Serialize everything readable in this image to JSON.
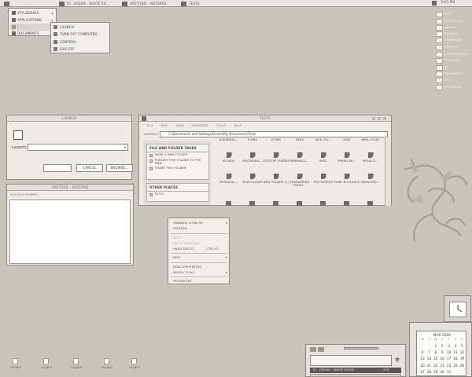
{
  "taskbar": {
    "tasks": [
      "01. Cream - White Ro...",
      "Untitled - Notepad",
      "Tests"
    ],
    "clock": "3:05 PM"
  },
  "start_menu": {
    "items": [
      "Styleboxes",
      "Applications",
      "Dmbra",
      "Documents"
    ]
  },
  "submenu": {
    "items": [
      "Launch",
      "Turn off computer...",
      "Control",
      "Log off"
    ]
  },
  "launch": {
    "title": "Launch",
    "label": "Launch:",
    "cancel": "Cancel",
    "browse": "Browse..."
  },
  "notepad": {
    "title": "Untitled - Notepad",
    "menu": "File Edit Format",
    "text": ""
  },
  "explorer": {
    "title": "Tests",
    "menu": [
      "File",
      "Edit",
      "View",
      "Favorites",
      "Tools",
      "Help"
    ],
    "address_label": "Address",
    "address": "C:\\Documents and Settings\\Daniel\\My Documents\\Tests",
    "tasks_title": "File and Folder Tasks",
    "tasks": [
      "Make a new folder",
      "Publish this folder to the Web",
      "Share this folder"
    ],
    "places_title": "Other Places",
    "places_item": "Docs",
    "files_row1": [
      "Augerdal...",
      "Icons",
      "Icons",
      "Imgs",
      "Jack_Tic...",
      "Jose",
      "Kiwi_Lousy"
    ],
    "files_row2": [
      "Killbill",
      "Kultering...",
      "Litestep Themes",
      "Minimalic...",
      "Misc",
      "Mixellar...",
      "Mysql-4..."
    ],
    "files_row3": [
      "Myvisual...",
      "New Folder",
      "New Folder (2)",
      "Passwords Proxy...",
      "Photoshop",
      "Pixel Elegance",
      "Reinlord..."
    ]
  },
  "context_menu": {
    "items": [
      {
        "label": "Arrange Icons By",
        "arrow": true,
        "disabled": false
      },
      {
        "label": "Refresh",
        "arrow": false,
        "disabled": false
      },
      {
        "label": "Paste",
        "arrow": false,
        "disabled": true
      },
      {
        "label": "Paste Shortcut",
        "arrow": false,
        "disabled": true
      },
      {
        "label": "Undo Delete",
        "arrow": false,
        "disabled": false,
        "shortcut": "Ctrl+Z"
      },
      {
        "label": "New",
        "arrow": true,
        "disabled": false
      },
      {
        "label": "Nokia Properties",
        "arrow": false,
        "disabled": false
      },
      {
        "label": "Nvidia Tools",
        "arrow": true,
        "disabled": false
      },
      {
        "label": "Properties",
        "arrow": false,
        "disabled": false
      }
    ]
  },
  "desktop_right": {
    "items": [
      "Brm",
      "Recycle Bin",
      "Avatars",
      "Folder",
      "Downloads",
      "Lazarus",
      "Litestep Theme",
      "Lockdown",
      "Ms",
      "Wallpaper",
      "Brm",
      "Photoshop"
    ]
  },
  "desktop_bottom": {
    "items": [
      "Folder",
      "Folder",
      "Folder",
      "Folder",
      "Folder"
    ]
  },
  "calendar": {
    "month": "Mar 2006",
    "day_headers": [
      "M",
      "T",
      "W",
      "T",
      "F",
      "S",
      "S"
    ],
    "weeks": [
      [
        "",
        "",
        "1",
        "2",
        "3",
        "4",
        "5"
      ],
      [
        "6",
        "7",
        "8",
        "9",
        "10",
        "11",
        "12"
      ],
      [
        "13",
        "14",
        "15",
        "16",
        "17",
        "18",
        "19"
      ],
      [
        "20",
        "21",
        "22",
        "23",
        "24",
        "25",
        "26"
      ],
      [
        "27",
        "28",
        "29",
        "30",
        "31",
        "",
        ""
      ]
    ]
  },
  "player": {
    "track": "01. Cream - White Room",
    "time": "4:50"
  },
  "colors": {
    "desktop": "#c8c6bc",
    "window": "#ecebe4",
    "accent": "#6b6a66"
  }
}
